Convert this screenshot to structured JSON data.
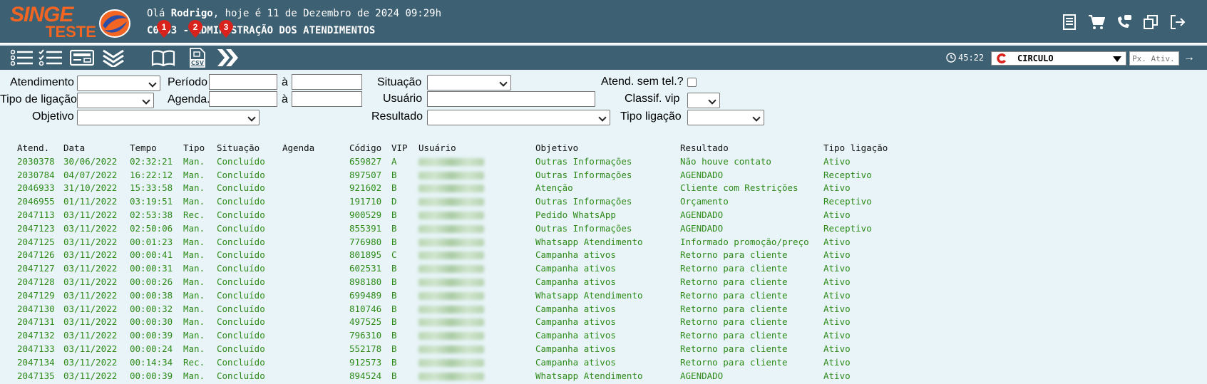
{
  "header": {
    "logo_top": "SINGE",
    "logo_bottom": "TESTE",
    "greeting_prefix": "Olá ",
    "user_name": "Rodrigo",
    "greeting_suffix": ", hoje é 11 de Dezembro de 2024 09:29h",
    "module_title": "C0103 - ADMINISTRAÇÃO DOS ATENDIMENTOS",
    "icons": [
      "report-icon",
      "cart-icon",
      "phone-chat-icon",
      "switch-window-icon",
      "logout-icon"
    ]
  },
  "toolbar": {
    "icons": [
      "list-icon",
      "checklist-icon",
      "card-icon",
      "expand-down-icon",
      "book-icon",
      "csv-icon",
      "forward-icon"
    ],
    "badges": [
      "1",
      "2",
      "3"
    ],
    "timer": "45:22",
    "branch_select": "CIRCULO",
    "next_placeholder": "Px. Ativ.",
    "go_arrow": "→"
  },
  "filters": {
    "atendimento": "Atendimento",
    "periodo": "Período",
    "a1": "à",
    "situacao": "Situação",
    "sem_tel": "Atend. sem tel.?",
    "tipo_ligacao_left": "Tipo de ligação",
    "agenda": "Agenda.",
    "a2": "à",
    "usuario": "Usuário",
    "classif_vip": "Classif. vip",
    "objetivo": "Objetivo",
    "resultado": "Resultado",
    "tipo_ligacao_right": "Tipo ligação"
  },
  "table": {
    "headers": [
      "Atend.",
      "Data",
      "Tempo",
      "Tipo",
      "Situação",
      "Agenda",
      "Código",
      "VIP",
      "Usuário",
      "Objetivo",
      "Resultado",
      "Tipo ligação"
    ],
    "rows": [
      [
        "2030378",
        "30/06/2022",
        "02:32:21",
        "Man.",
        "Concluído",
        "",
        "659827",
        "A",
        "",
        "Outras Informações",
        "Não houve contato",
        "Ativo"
      ],
      [
        "2030784",
        "04/07/2022",
        "16:22:12",
        "Man.",
        "Concluído",
        "",
        "897507",
        "B",
        "",
        "Outras Informações",
        "AGENDADO",
        "Receptivo"
      ],
      [
        "2046933",
        "31/10/2022",
        "15:33:58",
        "Man.",
        "Concluído",
        "",
        "921602",
        "B",
        "",
        "Atenção",
        "Cliente com Restrições",
        "Ativo"
      ],
      [
        "2046955",
        "01/11/2022",
        "03:19:51",
        "Man.",
        "Concluído",
        "",
        "191710",
        "D",
        "",
        "Outras Informações",
        "Orçamento",
        "Receptivo"
      ],
      [
        "2047113",
        "03/11/2022",
        "02:53:38",
        "Rec.",
        "Concluído",
        "",
        "900529",
        "B",
        "",
        "Pedido WhatsApp",
        "AGENDADO",
        "Ativo"
      ],
      [
        "2047123",
        "03/11/2022",
        "02:50:06",
        "Man.",
        "Concluído",
        "",
        "855391",
        "B",
        "",
        "Outras Informações",
        "AGENDADO",
        "Receptivo"
      ],
      [
        "2047125",
        "03/11/2022",
        "00:01:23",
        "Man.",
        "Concluído",
        "",
        "776980",
        "B",
        "",
        "Whatsapp Atendimento",
        "Informado promoção/preço",
        "Ativo"
      ],
      [
        "2047126",
        "03/11/2022",
        "00:00:41",
        "Man.",
        "Concluído",
        "",
        "801895",
        "C",
        "",
        "Campanha ativos",
        "Retorno para cliente",
        "Ativo"
      ],
      [
        "2047127",
        "03/11/2022",
        "00:00:31",
        "Man.",
        "Concluído",
        "",
        "602531",
        "B",
        "",
        "Campanha ativos",
        "Retorno para cliente",
        "Ativo"
      ],
      [
        "2047128",
        "03/11/2022",
        "00:00:26",
        "Man.",
        "Concluído",
        "",
        "898180",
        "B",
        "",
        "Campanha ativos",
        "Retorno para cliente",
        "Ativo"
      ],
      [
        "2047129",
        "03/11/2022",
        "00:00:38",
        "Man.",
        "Concluído",
        "",
        "699489",
        "B",
        "",
        "Whatsapp Atendimento",
        "Retorno para cliente",
        "Ativo"
      ],
      [
        "2047130",
        "03/11/2022",
        "00:00:32",
        "Man.",
        "Concluído",
        "",
        "810746",
        "B",
        "",
        "Campanha ativos",
        "Retorno para cliente",
        "Ativo"
      ],
      [
        "2047131",
        "03/11/2022",
        "00:00:30",
        "Man.",
        "Concluído",
        "",
        "497525",
        "B",
        "",
        "Campanha ativos",
        "Retorno para cliente",
        "Ativo"
      ],
      [
        "2047132",
        "03/11/2022",
        "00:00:39",
        "Man.",
        "Concluído",
        "",
        "796310",
        "B",
        "",
        "Campanha ativos",
        "Retorno para cliente",
        "Ativo"
      ],
      [
        "2047133",
        "03/11/2022",
        "00:00:24",
        "Man.",
        "Concluído",
        "",
        "552178",
        "B",
        "",
        "Campanha ativos",
        "Retorno para cliente",
        "Ativo"
      ],
      [
        "2047134",
        "03/11/2022",
        "00:14:34",
        "Rec.",
        "Concluído",
        "",
        "912573",
        "B",
        "",
        "Campanha ativos",
        "Retorno para cliente",
        "Ativo"
      ],
      [
        "2047135",
        "03/11/2022",
        "00:00:39",
        "Man.",
        "Concluído",
        "",
        "894524",
        "B",
        "",
        "Whatsapp Atendimento",
        "AGENDADO",
        "Ativo"
      ]
    ]
  },
  "colors": {
    "header_bg": "#3e6073",
    "page_bg": "#e8f4f8",
    "row_text": "#2e8b1a",
    "logo_orange": "#f26522",
    "badge_red": "#d9221c"
  }
}
